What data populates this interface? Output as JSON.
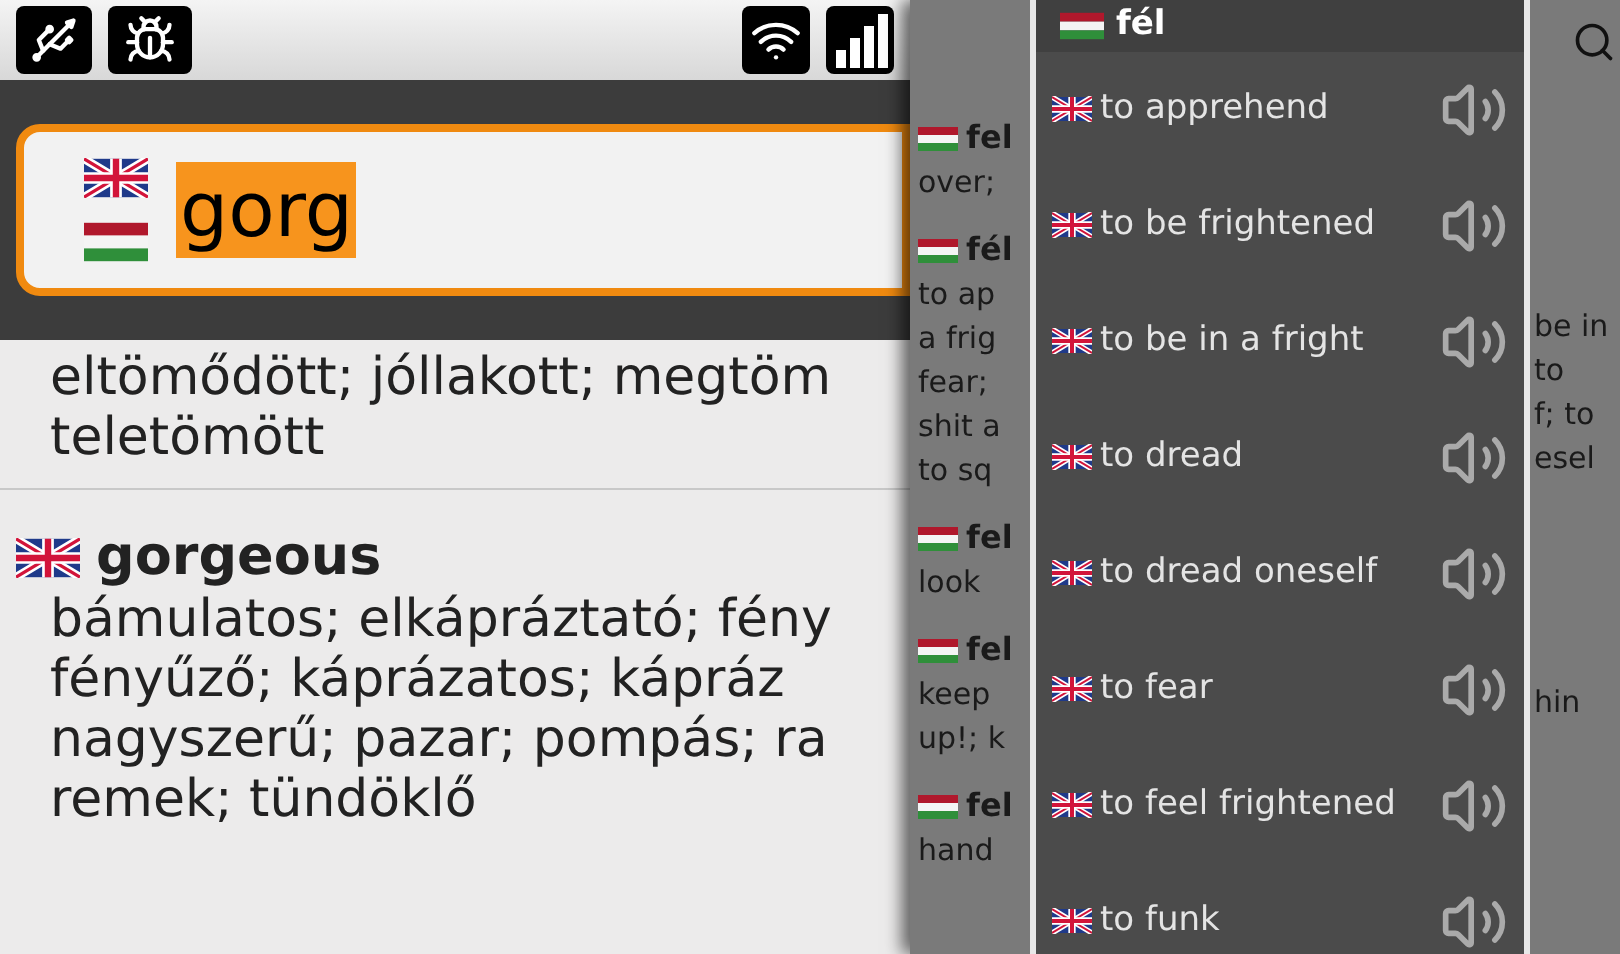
{
  "search": {
    "value": "gorg",
    "flags": [
      {
        "kind": "en"
      },
      {
        "kind": "hu"
      }
    ]
  },
  "results": [
    {
      "lines": [
        "eltömődött; jóllakott; megtöm",
        "teletömött"
      ]
    },
    {
      "kind": "en",
      "headword": "gorgeous",
      "lines": [
        "bámulatos; elkápráztató; fény",
        "fényűző; káprázatos; kápráz",
        "nagyszerű; pazar; pompás; ra",
        "remek; tündöklő"
      ]
    }
  ],
  "background_list": {
    "entries": [
      {
        "kind": "hu",
        "headword": "fel",
        "lines": [
          "over;"
        ]
      },
      {
        "kind": "hu",
        "headword": "fél",
        "lines": [
          "to ap",
          "a frig",
          "fear;",
          "shit a",
          "to sq"
        ]
      },
      {
        "kind": "hu",
        "headword": "fel",
        "lines": [
          "look"
        ]
      },
      {
        "kind": "hu",
        "headword": "fel",
        "lines": [
          "keep",
          "up!; k"
        ]
      },
      {
        "kind": "hu",
        "headword": "fel",
        "lines": [
          "hand"
        ]
      }
    ],
    "right_fragments": [
      {
        "lines": [
          "be in",
          "to",
          "f; to",
          "esel"
        ]
      },
      {
        "lines": [
          "hin"
        ]
      }
    ]
  },
  "popup": {
    "kind": "hu",
    "headword": "fél",
    "translations": [
      {
        "kind": "en",
        "text": "to apprehend"
      },
      {
        "kind": "en",
        "text": "to be frightened"
      },
      {
        "kind": "en",
        "text": "to be in a fright"
      },
      {
        "kind": "en",
        "text": "to dread"
      },
      {
        "kind": "en",
        "text": "to dread oneself"
      },
      {
        "kind": "en",
        "text": "to fear"
      },
      {
        "kind": "en",
        "text": "to feel frightened"
      },
      {
        "kind": "en",
        "text": "to funk"
      }
    ]
  }
}
